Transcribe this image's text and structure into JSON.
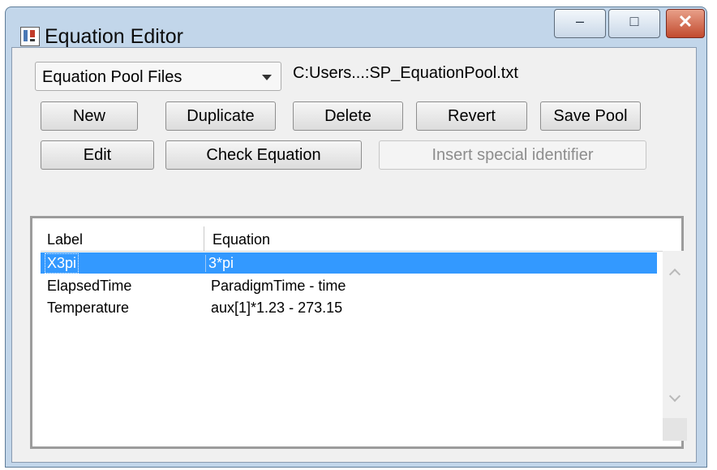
{
  "window": {
    "title": "Equation Editor"
  },
  "pool": {
    "selector_value": "Equation Pool Files",
    "path_text": "C:Users...:SP_EquationPool.txt"
  },
  "toolbar": {
    "new_label": "New",
    "duplicate_label": "Duplicate",
    "delete_label": "Delete",
    "revert_label": "Revert",
    "save_pool_label": "Save Pool",
    "edit_label": "Edit",
    "check_equation_label": "Check Equation",
    "insert_identifier_label": "Insert special identifier"
  },
  "table": {
    "headers": [
      "Label",
      "Equation"
    ],
    "rows": [
      {
        "label": "X3pi",
        "equation": "3*pi",
        "selected": true
      },
      {
        "label": "ElapsedTime",
        "equation": "ParadigmTime - time",
        "selected": false
      },
      {
        "label": "Temperature",
        "equation": "aux[1]*1.23 - 273.15",
        "selected": false
      }
    ]
  },
  "icons": {
    "app": "equation-editor-icon",
    "minimize": "minimize-icon",
    "maximize": "maximize-icon",
    "close": "close-icon",
    "dropdown": "chevron-down-icon",
    "scroll_up": "chevron-up-icon",
    "scroll_down": "chevron-down-icon"
  },
  "colors": {
    "selection": "#3399ff",
    "titlebar": "#c2d6ea",
    "close_button": "#c24a2e"
  }
}
